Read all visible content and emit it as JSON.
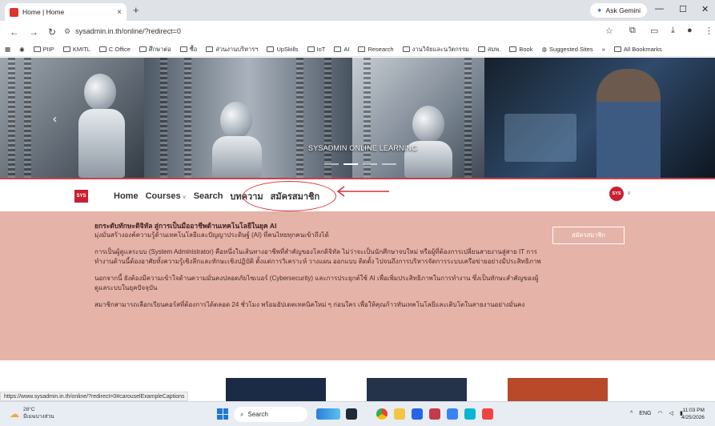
{
  "browser": {
    "tab": {
      "title": "Home | Home",
      "close": "×"
    },
    "new_tab": "+",
    "gemini": "Ask Gemini",
    "window": {
      "minimize": "—",
      "maximize": "☐",
      "close": "✕"
    },
    "url": "sysadmin.in.th/online/?redirect=0",
    "bookmarks": [
      "PIIP",
      "KMITL",
      "C Office",
      "ศึกษาต่อ",
      "ซื้อ",
      "ส่วนงานบริหารฯ",
      "UpSkills",
      "IoT",
      "AI",
      "Research",
      "งานวิจัยและนวัตกรรม",
      "สมพ.",
      "Book",
      "Suggested Sites"
    ],
    "bookmarks_more": "»",
    "all_bookmarks": "All Bookmarks"
  },
  "hero": {
    "caption": "SYSADMIN ONLINE LEARNING",
    "prev": "‹",
    "slides": 4,
    "active_slide": 1
  },
  "nav": {
    "logo": "SYS",
    "items": [
      {
        "label": "Home",
        "dropdown": false
      },
      {
        "label": "Courses",
        "dropdown": true
      },
      {
        "label": "Search",
        "dropdown": false
      },
      {
        "label": "บทความ",
        "dropdown": false
      },
      {
        "label": "สมัครสมาชิก",
        "dropdown": false
      }
    ],
    "user_badge": "SYS"
  },
  "promo": {
    "title": "ยกระดับทักษะดิจิทัล สู่การเป็นมืออาชีพด้านเทคโนโลยีในยุค AI",
    "subtitle": "มุ่งมั่นสร้างองค์ความรู้ด้านเทคโนโลยีและปัญญาประดิษฐ์ (AI) ที่คนไทยทุกคนเข้าถึงได้",
    "para1": "การเป็นผู้ดูแลระบบ (System Administrator) คือหนึ่งในเส้นทางอาชีพที่สำคัญของโลกดิจิทัล ไม่ว่าจะเป็นนักศึกษาจบใหม่ หรือผู้ที่ต้องการเปลี่ยนสายงานสู่สาย IT การทำงานด้านนี้ต้องอาศัยทั้งความรู้เชิงลึกและทักษะเชิงปฏิบัติ ตั้งแต่การวิเคราะห์ วางแผน ออกแบบ ติดตั้ง ไปจนถึงการบริหารจัดการระบบเครือข่ายอย่างมีประสิทธิภาพ",
    "para2": "นอกจากนี้ ยังต้องมีความเข้าใจด้านความมั่นคงปลอดภัยไซเบอร์ (Cybersecurity) และการประยุกต์ใช้ AI เพื่อเพิ่มประสิทธิภาพในการทำงาน ซึ่งเป็นทักษะสำคัญของผู้ดูแลระบบในยุคปัจจุบัน",
    "para3": "สมาชิกสามารถเลือกเรียนคอร์สที่ต้องการได้ตลอด 24 ชั่วโมง พร้อมอัปเดตเทคนิคใหม่ ๆ ก่อนใคร เพื่อให้คุณก้าวทันเทคโนโลยีและเติบโตในสายงานอย่างมั่นคง",
    "button": "สมัครสมาชิก"
  },
  "status_url": "https://www.sysadmin.in.th/online/?redirect=0#carouselExampleCaptions",
  "taskbar": {
    "weather_temp": "28°C",
    "weather_desc": "มีเมฆบางส่วน",
    "search": "Search",
    "tray": [
      "^",
      "ENG"
    ],
    "time": "11:03 PM",
    "date": "4/25/2026"
  },
  "colors": {
    "accent": "#c82032",
    "promo_bg": "#e6b3a8",
    "annotation": "#d2333c"
  }
}
